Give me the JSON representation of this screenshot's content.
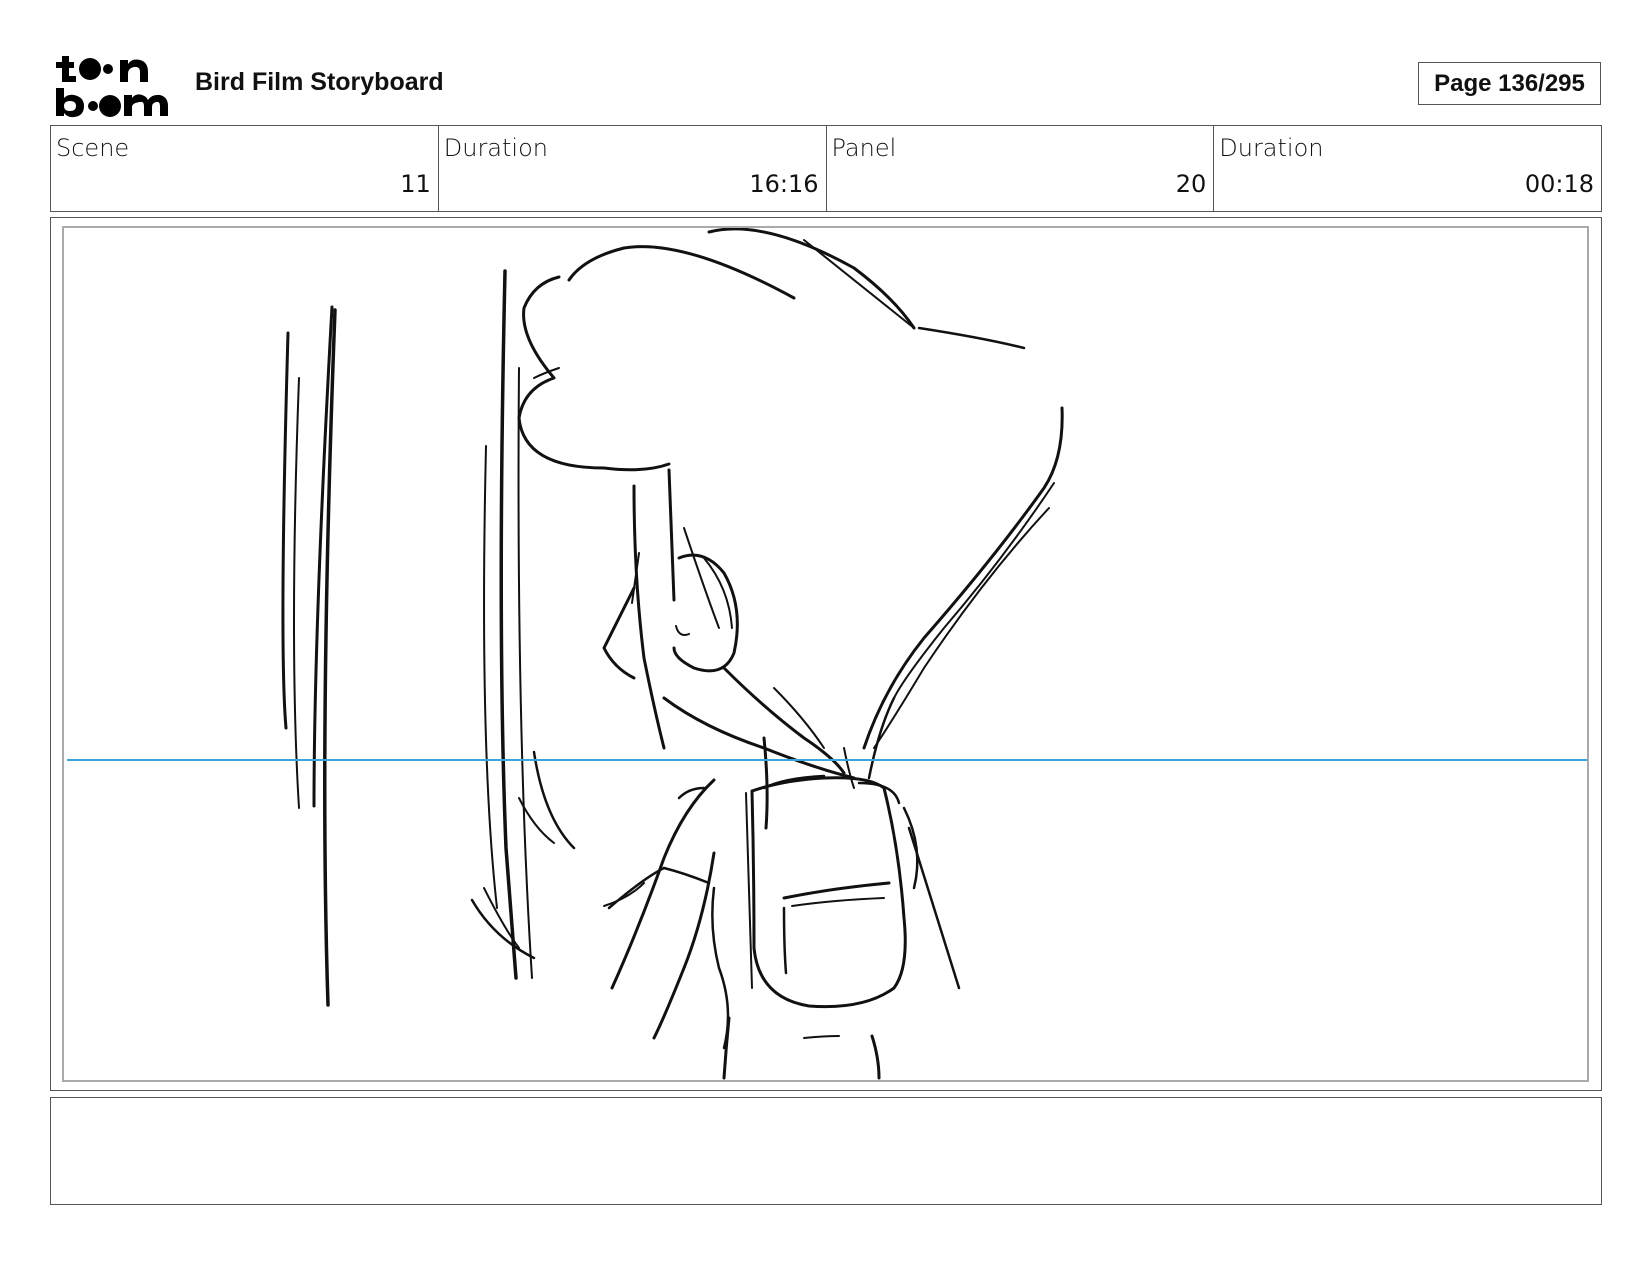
{
  "header": {
    "logo_text_top": "toon",
    "logo_text_bottom": "boom",
    "title": "Bird Film Storyboard",
    "page": "Page 136/295"
  },
  "info": {
    "scene_label": "Scene",
    "scene_value": "11",
    "scene_duration_label": "Duration",
    "scene_duration_value": "16:16",
    "panel_label": "Panel",
    "panel_value": "20",
    "panel_duration_label": "Duration",
    "panel_duration_value": "00:18"
  },
  "colors": {
    "horizon_line": "#3aa5dc",
    "frame_border": "#555555"
  },
  "notes": ""
}
